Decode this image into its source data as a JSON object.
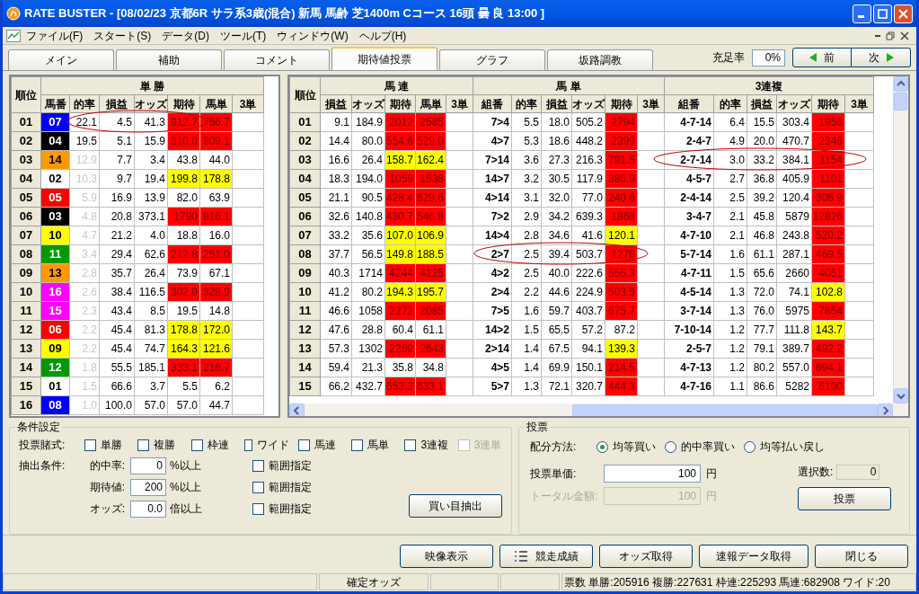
{
  "window": {
    "title": "RATE BUSTER - [08/02/23 京都6R サラ系3歳(混合) 新馬 馬齢 芝1400m Cコース 16頭 曇 良 13:00 ]"
  },
  "menu": [
    "ファイル(F)",
    "スタート(S)",
    "データ(D)",
    "ツール(T)",
    "ウィンドウ(W)",
    "ヘルプ(H)"
  ],
  "tabs": [
    {
      "label": "メイン",
      "selected": false
    },
    {
      "label": "補助",
      "selected": false
    },
    {
      "label": "コメント",
      "selected": false
    },
    {
      "label": "期待値投票",
      "selected": true
    },
    {
      "label": "グラフ",
      "selected": false
    },
    {
      "label": "坂路調教",
      "selected": false
    }
  ],
  "fill_rate": {
    "label": "充足率",
    "value": "0%"
  },
  "nav": {
    "prev": "前",
    "next": "次"
  },
  "win_table": {
    "rank_header": "順位",
    "group": "単 勝",
    "columns": [
      "馬番",
      "的率",
      "損益",
      "オッズ",
      "期待",
      "馬単",
      "3単"
    ],
    "rows": [
      {
        "rank": "01",
        "horse": {
          "number": "07",
          "color": "#0000ff"
        },
        "hit_rate": "22.1",
        "dimmed": false,
        "profit": "4.5",
        "odds": "41.3",
        "expected": {
          "value": "912.7",
          "color": "#ff0000"
        },
        "exacta": {
          "value": "756.7",
          "color": "#ff0000"
        },
        "circled": true
      },
      {
        "rank": "02",
        "horse": {
          "number": "04",
          "color": "#000000"
        },
        "hit_rate": "19.5",
        "dimmed": false,
        "profit": "5.1",
        "odds": "15.9",
        "expected": {
          "value": "310.0",
          "color": "#ff0000"
        },
        "exacta": {
          "value": "309.1",
          "color": "#ff0000"
        },
        "circled": false
      },
      {
        "rank": "03",
        "horse": {
          "number": "14",
          "color": "#ff9900"
        },
        "hit_rate": "12.9",
        "dimmed": true,
        "profit": "7.7",
        "odds": "3.4",
        "expected": {
          "value": "43.8",
          "color": "#ffffff"
        },
        "exacta": {
          "value": "44.0",
          "color": "#ffffff"
        },
        "circled": false
      },
      {
        "rank": "04",
        "horse": {
          "number": "02",
          "color": "#ffffff"
        },
        "hit_rate": "10.3",
        "dimmed": true,
        "profit": "9.7",
        "odds": "19.4",
        "expected": {
          "value": "199.8",
          "color": "#ffff00"
        },
        "exacta": {
          "value": "178.8",
          "color": "#ffff00"
        },
        "circled": false
      },
      {
        "rank": "05",
        "horse": {
          "number": "05",
          "color": "#ff0000"
        },
        "hit_rate": "5.9",
        "dimmed": true,
        "profit": "16.9",
        "odds": "13.9",
        "expected": {
          "value": "82.0",
          "color": "#ffffff"
        },
        "exacta": {
          "value": "63.9",
          "color": "#ffffff"
        },
        "circled": false
      },
      {
        "rank": "06",
        "horse": {
          "number": "03",
          "color": "#000000"
        },
        "hit_rate": "4.8",
        "dimmed": true,
        "profit": "20.8",
        "odds": "373.1",
        "expected": {
          "value": "1790",
          "color": "#ff0000"
        },
        "exacta": {
          "value": "816.1",
          "color": "#ff0000"
        },
        "circled": false
      },
      {
        "rank": "07",
        "horse": {
          "number": "10",
          "color": "#ffff00"
        },
        "hit_rate": "4.7",
        "dimmed": true,
        "profit": "21.2",
        "odds": "4.0",
        "expected": {
          "value": "18.8",
          "color": "#ffffff"
        },
        "exacta": {
          "value": "16.0",
          "color": "#ffffff"
        },
        "circled": false
      },
      {
        "rank": "08",
        "horse": {
          "number": "11",
          "color": "#009900"
        },
        "hit_rate": "3.4",
        "dimmed": true,
        "profit": "29.4",
        "odds": "62.6",
        "expected": {
          "value": "212.8",
          "color": "#ff0000"
        },
        "exacta": {
          "value": "251.0",
          "color": "#ff0000"
        },
        "circled": false
      },
      {
        "rank": "09",
        "horse": {
          "number": "13",
          "color": "#ff9900"
        },
        "hit_rate": "2.8",
        "dimmed": true,
        "profit": "35.7",
        "odds": "26.4",
        "expected": {
          "value": "73.9",
          "color": "#ffffff"
        },
        "exacta": {
          "value": "67.1",
          "color": "#ffffff"
        },
        "circled": false
      },
      {
        "rank": "10",
        "horse": {
          "number": "16",
          "color": "#ff00ff"
        },
        "hit_rate": "2.6",
        "dimmed": true,
        "profit": "38.4",
        "odds": "116.5",
        "expected": {
          "value": "302.9",
          "color": "#ff0000"
        },
        "exacta": {
          "value": "328.9",
          "color": "#ff0000"
        },
        "circled": false
      },
      {
        "rank": "11",
        "horse": {
          "number": "15",
          "color": "#ff00ff"
        },
        "hit_rate": "2.3",
        "dimmed": true,
        "profit": "43.4",
        "odds": "8.5",
        "expected": {
          "value": "19.5",
          "color": "#ffffff"
        },
        "exacta": {
          "value": "14.8",
          "color": "#ffffff"
        },
        "circled": false
      },
      {
        "rank": "12",
        "horse": {
          "number": "06",
          "color": "#ff0000"
        },
        "hit_rate": "2.2",
        "dimmed": true,
        "profit": "45.4",
        "odds": "81.3",
        "expected": {
          "value": "178.8",
          "color": "#ffff00"
        },
        "exacta": {
          "value": "172.0",
          "color": "#ffff00"
        },
        "circled": false
      },
      {
        "rank": "13",
        "horse": {
          "number": "09",
          "color": "#ffff00"
        },
        "hit_rate": "2.2",
        "dimmed": true,
        "profit": "45.4",
        "odds": "74.7",
        "expected": {
          "value": "164.3",
          "color": "#ffff00"
        },
        "exacta": {
          "value": "121.6",
          "color": "#ffff00"
        },
        "circled": false
      },
      {
        "rank": "14",
        "horse": {
          "number": "12",
          "color": "#009900"
        },
        "hit_rate": "1.8",
        "dimmed": true,
        "profit": "55.5",
        "odds": "185.1",
        "expected": {
          "value": "333.1",
          "color": "#ff0000"
        },
        "exacta": {
          "value": "216.7",
          "color": "#ff0000"
        },
        "circled": false
      },
      {
        "rank": "15",
        "horse": {
          "number": "01",
          "color": "#ffffff"
        },
        "hit_rate": "1.5",
        "dimmed": true,
        "profit": "66.6",
        "odds": "3.7",
        "expected": {
          "value": "5.5",
          "color": "#ffffff"
        },
        "exacta": {
          "value": "6.2",
          "color": "#ffffff"
        },
        "circled": false
      },
      {
        "rank": "16",
        "horse": {
          "number": "08",
          "color": "#0000ff"
        },
        "hit_rate": "1.0",
        "dimmed": true,
        "profit": "100.0",
        "odds": "57.0",
        "expected": {
          "value": "57.0",
          "color": "#ffffff"
        },
        "exacta": {
          "value": "44.7",
          "color": "#ffffff"
        },
        "circled": false
      }
    ]
  },
  "combo_table": {
    "rank_header": "順位",
    "groups": [
      {
        "title": "馬 連",
        "columns": [
          "損益",
          "オッズ",
          "期待",
          "馬単",
          "3単"
        ]
      },
      {
        "title": "馬 単",
        "columns": [
          "組番",
          "的率",
          "損益",
          "オッズ",
          "期待",
          "3単"
        ]
      },
      {
        "title": "3連複",
        "columns": [
          "組番",
          "的率",
          "損益",
          "オッズ",
          "期待",
          "3単"
        ]
      }
    ],
    "rows": [
      {
        "rank": "01",
        "quinella": {
          "profit": "9.1",
          "odds": "184.9",
          "expected": {
            "value": "2012",
            "color": "#ff0000"
          },
          "exacta": {
            "value": "2585",
            "color": "#ff0000"
          }
        },
        "exacta": {
          "combo": "7>4",
          "hit_rate": "5.5",
          "profit": "18.0",
          "odds": "505.2",
          "expected": {
            "value": "2794",
            "color": "#ff0000"
          },
          "circled": false
        },
        "trio": {
          "combo": "4-7-14",
          "hit_rate": "6.4",
          "profit": "15.5",
          "odds": "303.4",
          "expected": {
            "value": "1956",
            "color": "#ff0000"
          },
          "circled": false
        }
      },
      {
        "rank": "02",
        "quinella": {
          "profit": "14.4",
          "odds": "80.0",
          "expected": {
            "value": "554.6",
            "color": "#ff0000"
          },
          "exacta": {
            "value": "529.0",
            "color": "#ff0000"
          }
        },
        "exacta": {
          "combo": "4>7",
          "hit_rate": "5.3",
          "profit": "18.6",
          "odds": "448.2",
          "expected": {
            "value": "2399",
            "color": "#ff0000"
          },
          "circled": false
        },
        "trio": {
          "combo": "2-4-7",
          "hit_rate": "4.9",
          "profit": "20.0",
          "odds": "470.7",
          "expected": {
            "value": "2346",
            "color": "#ff0000"
          },
          "circled": false
        }
      },
      {
        "rank": "03",
        "quinella": {
          "profit": "16.6",
          "odds": "26.4",
          "expected": {
            "value": "158.7",
            "color": "#ffff00"
          },
          "exacta": {
            "value": "162.4",
            "color": "#ffff00"
          }
        },
        "exacta": {
          "combo": "7>14",
          "hit_rate": "3.6",
          "profit": "27.3",
          "odds": "216.3",
          "expected": {
            "value": "791.5",
            "color": "#ff0000"
          },
          "circled": false
        },
        "trio": {
          "combo": "2-7-14",
          "hit_rate": "3.0",
          "profit": "33.2",
          "odds": "384.1",
          "expected": {
            "value": "1154",
            "color": "#ff0000"
          },
          "circled": true
        }
      },
      {
        "rank": "04",
        "quinella": {
          "profit": "18.3",
          "odds": "194.0",
          "expected": {
            "value": "1059",
            "color": "#ff0000"
          },
          "exacta": {
            "value": "1538",
            "color": "#ff0000"
          }
        },
        "exacta": {
          "combo": "14>7",
          "hit_rate": "3.2",
          "profit": "30.5",
          "odds": "117.9",
          "expected": {
            "value": "385.9",
            "color": "#ff0000"
          },
          "circled": false
        },
        "trio": {
          "combo": "4-5-7",
          "hit_rate": "2.7",
          "profit": "36.8",
          "odds": "405.9",
          "expected": {
            "value": "1101",
            "color": "#ff0000"
          },
          "circled": false
        }
      },
      {
        "rank": "05",
        "quinella": {
          "profit": "21.1",
          "odds": "90.5",
          "expected": {
            "value": "428.4",
            "color": "#ff0000"
          },
          "exacta": {
            "value": "629.6",
            "color": "#ff0000"
          }
        },
        "exacta": {
          "combo": "4>14",
          "hit_rate": "3.1",
          "profit": "32.0",
          "odds": "77.0",
          "expected": {
            "value": "240.6",
            "color": "#ff0000"
          },
          "circled": false
        },
        "trio": {
          "combo": "2-4-14",
          "hit_rate": "2.5",
          "profit": "39.2",
          "odds": "120.4",
          "expected": {
            "value": "306.9",
            "color": "#ff0000"
          },
          "circled": false
        }
      },
      {
        "rank": "06",
        "quinella": {
          "profit": "32.6",
          "odds": "140.8",
          "expected": {
            "value": "430.7",
            "color": "#ff0000"
          },
          "exacta": {
            "value": "546.8",
            "color": "#ff0000"
          }
        },
        "exacta": {
          "combo": "7>2",
          "hit_rate": "2.9",
          "profit": "34.2",
          "odds": "639.3",
          "expected": {
            "value": "1868",
            "color": "#ff0000"
          },
          "circled": false
        },
        "trio": {
          "combo": "3-4-7",
          "hit_rate": "2.1",
          "profit": "45.8",
          "odds": "5879",
          "expected": {
            "value": "12826",
            "color": "#ff0000"
          },
          "circled": false
        }
      },
      {
        "rank": "07",
        "quinella": {
          "profit": "33.2",
          "odds": "35.6",
          "expected": {
            "value": "107.0",
            "color": "#ffff00"
          },
          "exacta": {
            "value": "106.9",
            "color": "#ffff00"
          }
        },
        "exacta": {
          "combo": "14>4",
          "hit_rate": "2.8",
          "profit": "34.6",
          "odds": "41.6",
          "expected": {
            "value": "120.1",
            "color": "#ffff00"
          },
          "circled": false
        },
        "trio": {
          "combo": "4-7-10",
          "hit_rate": "2.1",
          "profit": "46.8",
          "odds": "243.8",
          "expected": {
            "value": "520.2",
            "color": "#ff0000"
          },
          "circled": false
        }
      },
      {
        "rank": "08",
        "quinella": {
          "profit": "37.7",
          "odds": "56.5",
          "expected": {
            "value": "149.8",
            "color": "#ffff00"
          },
          "exacta": {
            "value": "188.5",
            "color": "#ffff00"
          }
        },
        "exacta": {
          "combo": "2>7",
          "hit_rate": "2.5",
          "profit": "39.4",
          "odds": "503.7",
          "expected": {
            "value": "1278",
            "color": "#ff0000"
          },
          "circled": true
        },
        "trio": {
          "combo": "5-7-14",
          "hit_rate": "1.6",
          "profit": "61.1",
          "odds": "287.1",
          "expected": {
            "value": "469.5",
            "color": "#ff0000"
          },
          "circled": false
        }
      },
      {
        "rank": "09",
        "quinella": {
          "profit": "40.3",
          "odds": "1714",
          "expected": {
            "value": "4244",
            "color": "#ff0000"
          },
          "exacta": {
            "value": "4125",
            "color": "#ff0000"
          }
        },
        "exacta": {
          "combo": "4>2",
          "hit_rate": "2.5",
          "profit": "40.0",
          "odds": "222.6",
          "expected": {
            "value": "555.3",
            "color": "#ff0000"
          },
          "circled": false
        },
        "trio": {
          "combo": "4-7-11",
          "hit_rate": "1.5",
          "profit": "65.6",
          "odds": "2660",
          "expected": {
            "value": "4051",
            "color": "#ff0000"
          },
          "circled": false
        }
      },
      {
        "rank": "10",
        "quinella": {
          "profit": "41.2",
          "odds": "80.2",
          "expected": {
            "value": "194.3",
            "color": "#ffff00"
          },
          "exacta": {
            "value": "195.7",
            "color": "#ffff00"
          }
        },
        "exacta": {
          "combo": "2>4",
          "hit_rate": "2.2",
          "profit": "44.6",
          "odds": "224.9",
          "expected": {
            "value": "503.5",
            "color": "#ff0000"
          },
          "circled": false
        },
        "trio": {
          "combo": "4-5-14",
          "hit_rate": "1.3",
          "profit": "72.0",
          "odds": "74.1",
          "expected": {
            "value": "102.8",
            "color": "#ffff00"
          },
          "circled": false
        }
      },
      {
        "rank": "11",
        "quinella": {
          "profit": "46.6",
          "odds": "1058",
          "expected": {
            "value": "2272",
            "color": "#ff0000"
          },
          "exacta": {
            "value": "2085",
            "color": "#ff0000"
          }
        },
        "exacta": {
          "combo": "7>5",
          "hit_rate": "1.6",
          "profit": "59.7",
          "odds": "403.7",
          "expected": {
            "value": "675.7",
            "color": "#ff0000"
          },
          "circled": false
        },
        "trio": {
          "combo": "3-7-14",
          "hit_rate": "1.3",
          "profit": "76.0",
          "odds": "5975",
          "expected": {
            "value": "7854",
            "color": "#ff0000"
          },
          "circled": false
        }
      },
      {
        "rank": "12",
        "quinella": {
          "profit": "47.6",
          "odds": "28.8",
          "expected": {
            "value": "60.4",
            "color": "#ffffff"
          },
          "exacta": {
            "value": "61.1",
            "color": "#ffffff"
          }
        },
        "exacta": {
          "combo": "14>2",
          "hit_rate": "1.5",
          "profit": "65.5",
          "odds": "57.2",
          "expected": {
            "value": "87.2",
            "color": "#ffffff"
          },
          "circled": false
        },
        "trio": {
          "combo": "7-10-14",
          "hit_rate": "1.2",
          "profit": "77.7",
          "odds": "111.8",
          "expected": {
            "value": "143.7",
            "color": "#ffff00"
          },
          "circled": false
        }
      },
      {
        "rank": "13",
        "quinella": {
          "profit": "57.3",
          "odds": "1302",
          "expected": {
            "value": "2269",
            "color": "#ff0000"
          },
          "exacta": {
            "value": "2643",
            "color": "#ff0000"
          }
        },
        "exacta": {
          "combo": "2>14",
          "hit_rate": "1.4",
          "profit": "67.5",
          "odds": "94.1",
          "expected": {
            "value": "139.3",
            "color": "#ffff00"
          },
          "circled": false
        },
        "trio": {
          "combo": "2-5-7",
          "hit_rate": "1.2",
          "profit": "79.1",
          "odds": "389.7",
          "expected": {
            "value": "492.2",
            "color": "#ff0000"
          },
          "circled": false
        }
      },
      {
        "rank": "14",
        "quinella": {
          "profit": "59.4",
          "odds": "21.3",
          "expected": {
            "value": "35.8",
            "color": "#ffffff"
          },
          "exacta": {
            "value": "34.8",
            "color": "#ffffff"
          }
        },
        "exacta": {
          "combo": "4>5",
          "hit_rate": "1.4",
          "profit": "69.9",
          "odds": "150.1",
          "expected": {
            "value": "214.5",
            "color": "#ff0000"
          },
          "circled": false
        },
        "trio": {
          "combo": "4-7-13",
          "hit_rate": "1.2",
          "profit": "80.2",
          "odds": "557.0",
          "expected": {
            "value": "694.1",
            "color": "#ff0000"
          },
          "circled": false
        }
      },
      {
        "rank": "15",
        "quinella": {
          "profit": "66.2",
          "odds": "432.7",
          "expected": {
            "value": "653.3",
            "color": "#ff0000"
          },
          "exacta": {
            "value": "633.1",
            "color": "#ff0000"
          }
        },
        "exacta": {
          "combo": "5>7",
          "hit_rate": "1.3",
          "profit": "72.1",
          "odds": "320.7",
          "expected": {
            "value": "444.3",
            "color": "#ff0000"
          },
          "circled": false
        },
        "trio": {
          "combo": "4-7-16",
          "hit_rate": "1.1",
          "profit": "86.6",
          "odds": "5282",
          "expected": {
            "value": "6100",
            "color": "#ff0000"
          },
          "circled": false
        }
      }
    ]
  },
  "conditions": {
    "title": "条件設定",
    "bet_types_label": "投票賭式:",
    "bet_types": [
      {
        "label": "単勝",
        "checked": false,
        "disabled": false
      },
      {
        "label": "複勝",
        "checked": false,
        "disabled": false
      },
      {
        "label": "枠連",
        "checked": false,
        "disabled": false
      },
      {
        "label": "ワイド",
        "checked": false,
        "disabled": false
      },
      {
        "label": "馬連",
        "checked": false,
        "disabled": false
      },
      {
        "label": "馬単",
        "checked": false,
        "disabled": false
      },
      {
        "label": "3連複",
        "checked": false,
        "disabled": false
      },
      {
        "label": "3連単",
        "checked": false,
        "disabled": true
      }
    ],
    "extract_label": "抽出条件:",
    "filters": [
      {
        "label": "的中率:",
        "value": "0",
        "unit": "%以上",
        "range_label": "範囲指定",
        "range_checked": false
      },
      {
        "label": "期待値:",
        "value": "200",
        "unit": "%以上",
        "range_label": "範囲指定",
        "range_checked": false
      },
      {
        "label": "オッズ:",
        "value": "0.0",
        "unit": "倍以上",
        "range_label": "範囲指定",
        "range_checked": false
      }
    ],
    "extract_button": "買い目抽出"
  },
  "vote": {
    "title": "投票",
    "method_label": "配分方法:",
    "methods": [
      {
        "label": "均等買い",
        "selected": true
      },
      {
        "label": "的中率買い",
        "selected": false
      },
      {
        "label": "均等払い戻し",
        "selected": false
      }
    ],
    "fields": [
      {
        "label": "投票単価:",
        "value": "100",
        "unit": "円",
        "disabled": false
      },
      {
        "label": "トータル金額:",
        "value": "100",
        "unit": "円",
        "disabled": true
      }
    ],
    "count": {
      "label": "選択数:",
      "value": "0"
    },
    "button": "投票"
  },
  "buttons": [
    {
      "label": "映像表示",
      "kind": "plain"
    },
    {
      "label": "競走成績",
      "kind": "list"
    },
    {
      "label": "オッズ取得",
      "kind": "plain"
    },
    {
      "label": "速報データ取得",
      "kind": "plain"
    },
    {
      "label": "閉じる",
      "kind": "plain"
    }
  ],
  "status_bar": {
    "odds_state": "確定オッズ",
    "votes": "票数 単勝:205916 複勝:227631 枠連:225293 馬連:682908 ワイド:20"
  }
}
